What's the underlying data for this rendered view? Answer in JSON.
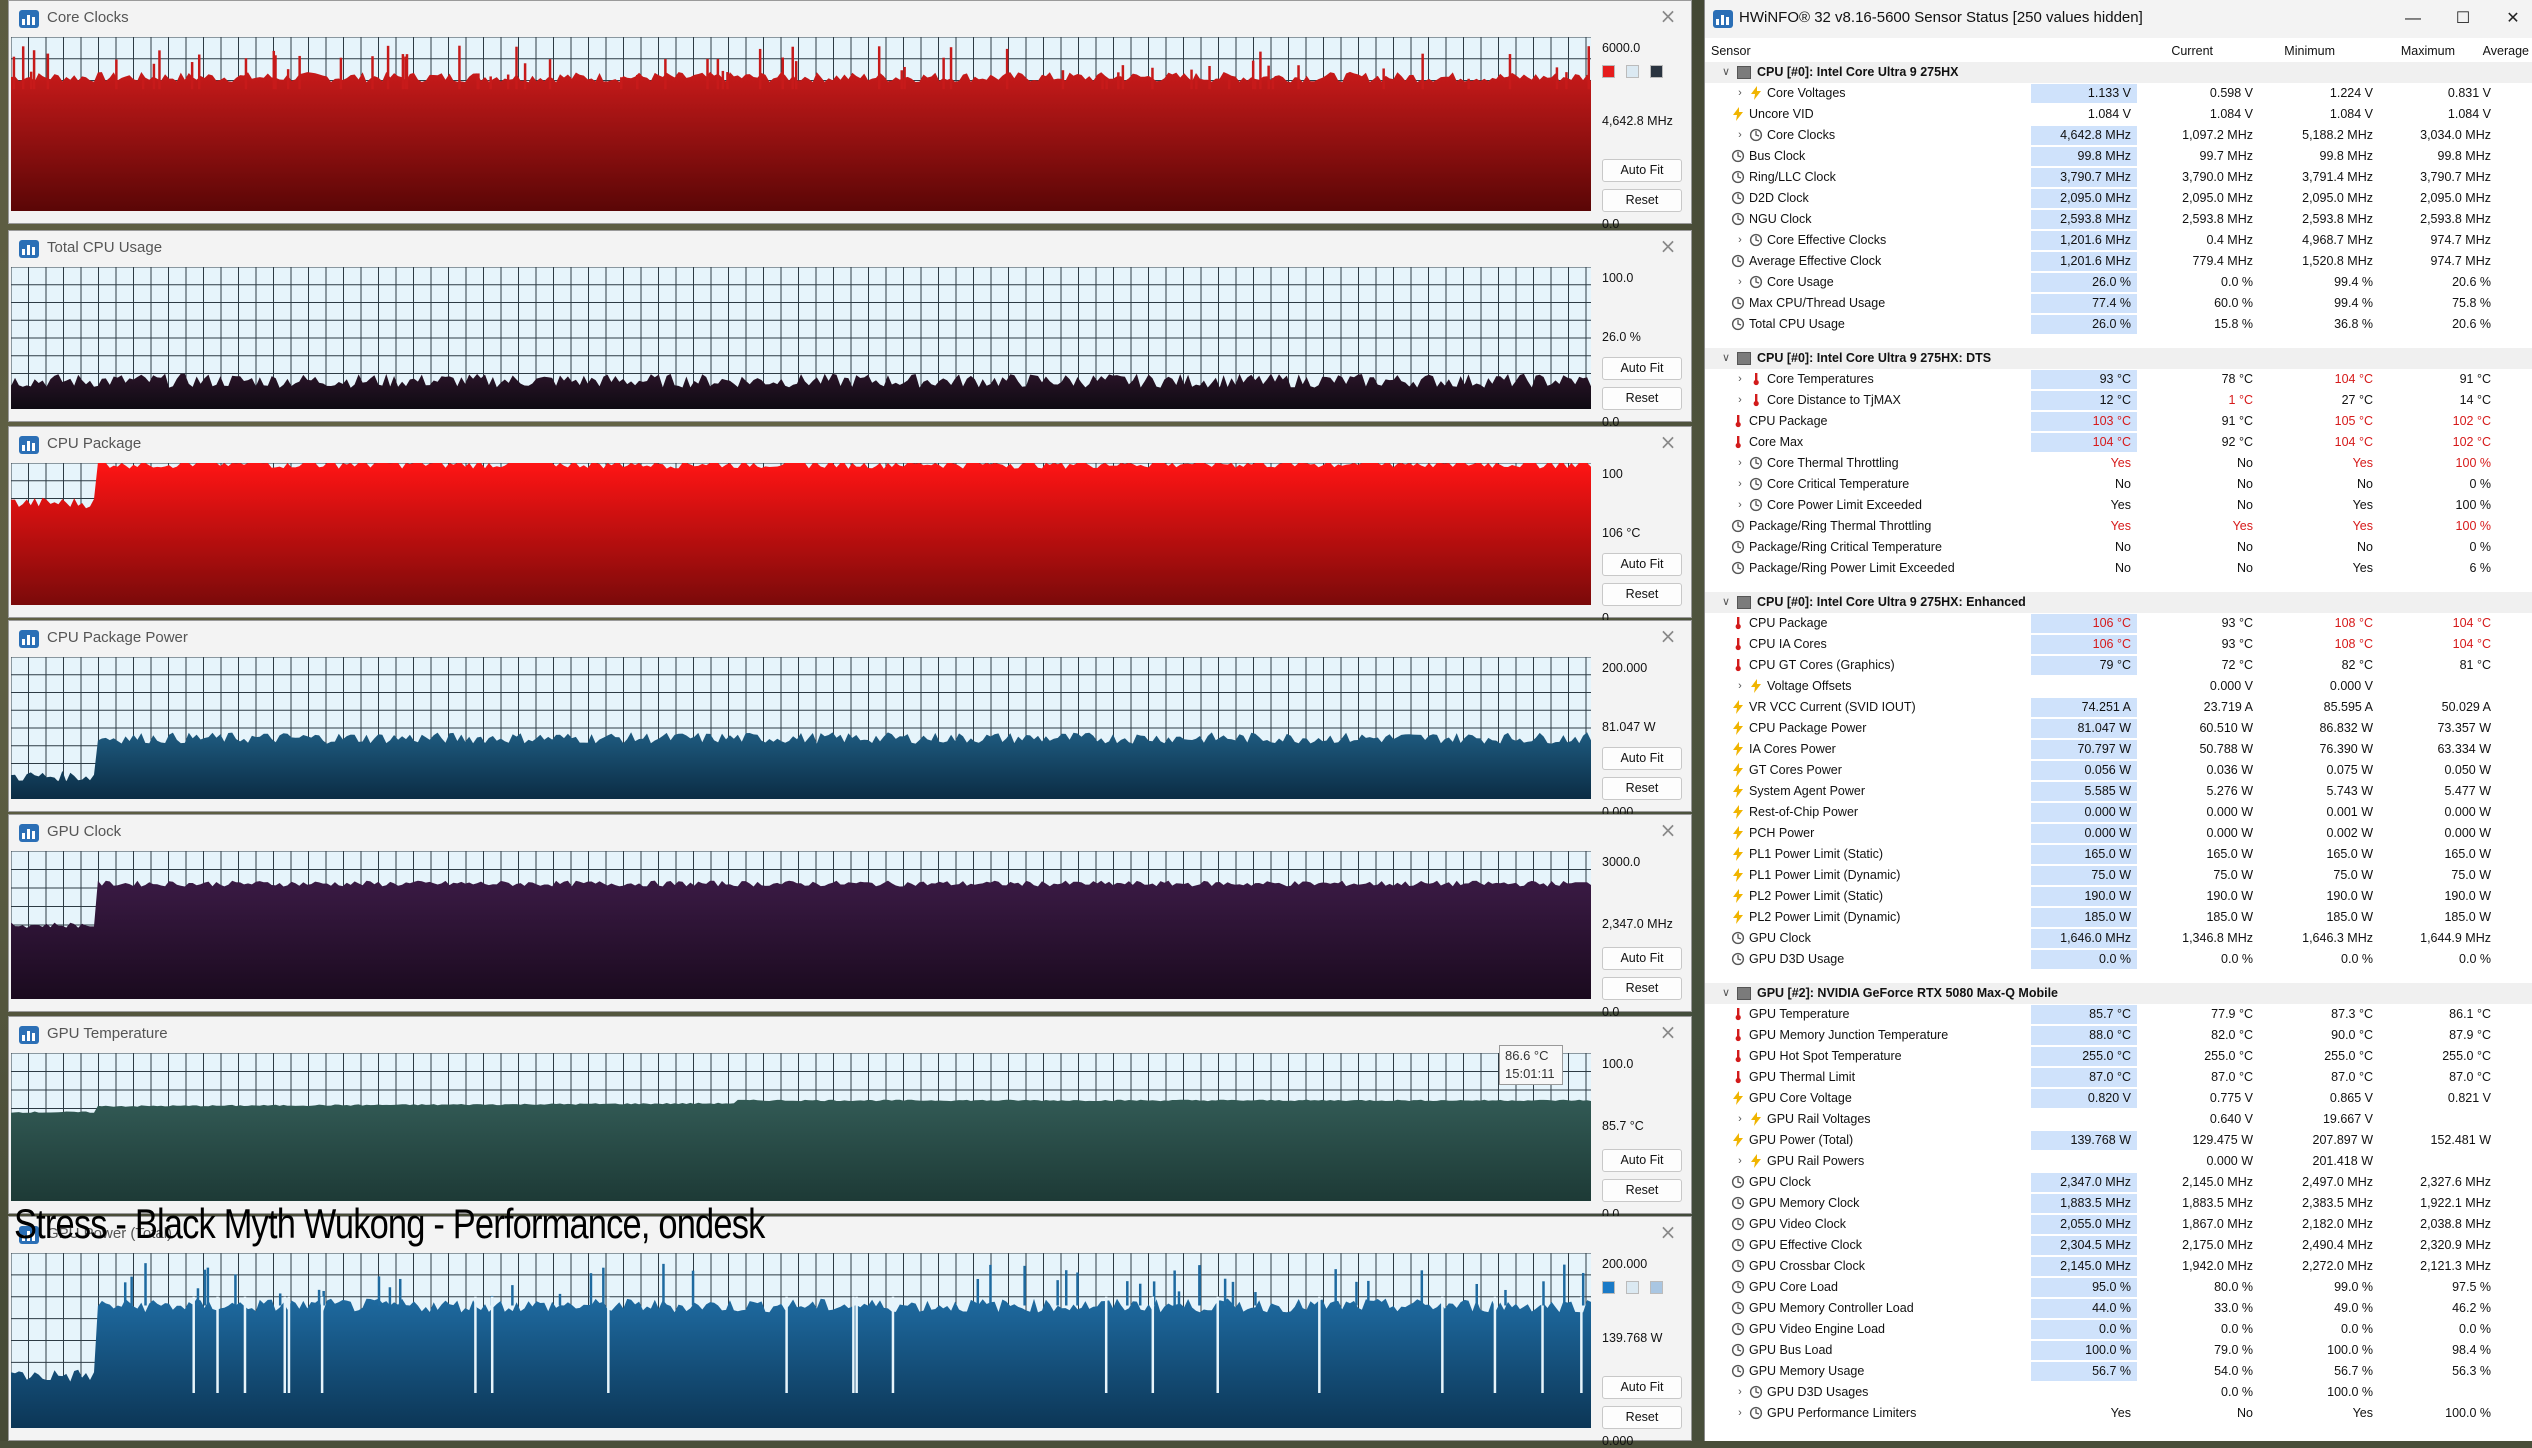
{
  "graphs": [
    {
      "title": "Core Clocks",
      "max": "6000.0",
      "current": "4,642.8 MHz",
      "min": "0.0",
      "autofit": "Auto Fit",
      "reset": "Reset",
      "swatches": [
        "#e51c1c",
        "#dbe9f2",
        "#2a3440"
      ],
      "series": {
        "color_top": "#c71a1a",
        "color_bottom": "#5a0606",
        "baseline_fraction": 0.77,
        "start_fraction": 0.77,
        "noise": 0.03,
        "spikes": true
      }
    },
    {
      "title": "Total CPU Usage",
      "max": "100.0",
      "current": "26.0 %",
      "min": "0.0",
      "autofit": "Auto Fit",
      "reset": "Reset",
      "swatches": [],
      "series": {
        "color_top": "#2a1428",
        "color_bottom": "#0e0a12",
        "baseline_fraction": 0.2,
        "start_fraction": 0.2,
        "noise": 0.05,
        "spikes": false
      }
    },
    {
      "title": "CPU Package",
      "max": "100",
      "current": "106 °C",
      "min": "0",
      "autofit": "Auto Fit",
      "reset": "Reset",
      "swatches": [],
      "series": {
        "color_top": "#ff1414",
        "color_bottom": "#7a0a0a",
        "baseline_fraction": 1.0,
        "start_fraction": 0.72,
        "noise": 0.04,
        "spikes": false
      }
    },
    {
      "title": "CPU Package Power",
      "max": "200.000",
      "current": "81.047 W",
      "min": "0.000",
      "autofit": "Auto Fit",
      "reset": "Reset",
      "swatches": [],
      "series": {
        "color_top": "#1e5b80",
        "color_bottom": "#0b2c44",
        "baseline_fraction": 0.43,
        "start_fraction": 0.16,
        "noise": 0.04,
        "spikes": false
      }
    },
    {
      "title": "GPU Clock",
      "max": "3000.0",
      "current": "2,347.0 MHz",
      "min": "0.0",
      "autofit": "Auto Fit",
      "reset": "Reset",
      "swatches": [],
      "series": {
        "color_top": "#3a1a44",
        "color_bottom": "#1a0a1e",
        "baseline_fraction": 0.78,
        "start_fraction": 0.5,
        "noise": 0.02,
        "spikes": false
      }
    },
    {
      "title": "GPU Temperature",
      "max": "100.0",
      "current": "85.7 °C",
      "min": "0.0",
      "autofit": "Auto Fit",
      "reset": "Reset",
      "swatches": [],
      "tooltip": {
        "line1": "86.6 °C",
        "line2": "15:01:11"
      },
      "series": {
        "color_top": "#325a55",
        "color_bottom": "#1d3a36",
        "baseline_fraction": 0.86,
        "start_fraction": 0.67,
        "noise": 0.005,
        "spikes": false
      }
    },
    {
      "title": "GPU Power (Total)",
      "max": "200.000",
      "current": "139.768 W",
      "min": "0.000",
      "autofit": "Auto Fit",
      "reset": "Reset",
      "swatches": [
        "#1a7ac6",
        "#dbe9f2",
        "#a9c6e2"
      ],
      "series": {
        "color_top": "#1e6aa0",
        "color_bottom": "#0c3656",
        "baseline_fraction": 0.7,
        "start_fraction": 0.3,
        "noise": 0.04,
        "spikes": true
      }
    }
  ],
  "overlay_caption": "Stress - Black Myth Wukong - Performance, ondesk",
  "hwinfo": {
    "title": "HWiNFO® 32 v8.16-5600 Sensor Status [250 values hidden]",
    "columns": {
      "sensor": "Sensor",
      "current": "Current",
      "minimum": "Minimum",
      "maximum": "Maximum",
      "average": "Average"
    },
    "rows": [
      {
        "type": "group",
        "label": "CPU [#0]: Intel Core Ultra 9 275HX"
      },
      {
        "label": "Core Voltages",
        "icon": "volt",
        "expand": true,
        "hl": true,
        "cur": "1.133 V",
        "min": "0.598 V",
        "max": "1.224 V",
        "avg": "0.831 V"
      },
      {
        "label": "Uncore VID",
        "icon": "volt",
        "hl": false,
        "cur": "1.084 V",
        "min": "1.084 V",
        "max": "1.084 V",
        "avg": "1.084 V"
      },
      {
        "label": "Core Clocks",
        "icon": "clock",
        "expand": true,
        "hl": true,
        "cur": "4,642.8 MHz",
        "min": "1,097.2 MHz",
        "max": "5,188.2 MHz",
        "avg": "3,034.0 MHz"
      },
      {
        "label": "Bus Clock",
        "icon": "clock",
        "hl": true,
        "cur": "99.8 MHz",
        "min": "99.7 MHz",
        "max": "99.8 MHz",
        "avg": "99.8 MHz"
      },
      {
        "label": "Ring/LLC Clock",
        "icon": "clock",
        "hl": true,
        "cur": "3,790.7 MHz",
        "min": "3,790.0 MHz",
        "max": "3,791.4 MHz",
        "avg": "3,790.7 MHz"
      },
      {
        "label": "D2D Clock",
        "icon": "clock",
        "hl": true,
        "cur": "2,095.0 MHz",
        "min": "2,095.0 MHz",
        "max": "2,095.0 MHz",
        "avg": "2,095.0 MHz"
      },
      {
        "label": "NGU Clock",
        "icon": "clock",
        "hl": true,
        "cur": "2,593.8 MHz",
        "min": "2,593.8 MHz",
        "max": "2,593.8 MHz",
        "avg": "2,593.8 MHz"
      },
      {
        "label": "Core Effective Clocks",
        "icon": "clock",
        "expand": true,
        "hl": true,
        "cur": "1,201.6 MHz",
        "min": "0.4 MHz",
        "max": "4,968.7 MHz",
        "avg": "974.7 MHz"
      },
      {
        "label": "Average Effective Clock",
        "icon": "clock",
        "hl": true,
        "cur": "1,201.6 MHz",
        "min": "779.4 MHz",
        "max": "1,520.8 MHz",
        "avg": "974.7 MHz"
      },
      {
        "label": "Core Usage",
        "icon": "clock",
        "expand": true,
        "hl": true,
        "cur": "26.0 %",
        "min": "0.0 %",
        "max": "99.4 %",
        "avg": "20.6 %"
      },
      {
        "label": "Max CPU/Thread Usage",
        "icon": "clock",
        "hl": true,
        "cur": "77.4 %",
        "min": "60.0 %",
        "max": "99.4 %",
        "avg": "75.8 %"
      },
      {
        "label": "Total CPU Usage",
        "icon": "clock",
        "hl": true,
        "cur": "26.0 %",
        "min": "15.8 %",
        "max": "36.8 %",
        "avg": "20.6 %"
      },
      {
        "type": "spacer"
      },
      {
        "type": "group",
        "label": "CPU [#0]: Intel Core Ultra 9 275HX: DTS"
      },
      {
        "label": "Core Temperatures",
        "icon": "temp",
        "expand": true,
        "hl": true,
        "cur": "93 °C",
        "min": "78 °C",
        "max": "104 °C",
        "avg": "91 °C",
        "maxRed": true
      },
      {
        "label": "Core Distance to TjMAX",
        "icon": "temp",
        "expand": true,
        "hl": true,
        "cur": "12 °C",
        "min": "1 °C",
        "max": "27 °C",
        "avg": "14 °C",
        "minRed": true
      },
      {
        "label": "CPU Package",
        "icon": "temp",
        "hl": true,
        "cur": "103 °C",
        "min": "91 °C",
        "max": "105 °C",
        "avg": "102 °C",
        "curRed": true,
        "maxRed": true,
        "avgRed": true
      },
      {
        "label": "Core Max",
        "icon": "temp",
        "hl": true,
        "cur": "104 °C",
        "min": "92 °C",
        "max": "104 °C",
        "avg": "102 °C",
        "curRed": true,
        "maxRed": true,
        "avgRed": true
      },
      {
        "label": "Core Thermal Throttling",
        "icon": "clock",
        "expand": true,
        "hl": false,
        "cur": "Yes",
        "min": "No",
        "max": "Yes",
        "avg": "100 %",
        "curRed": true,
        "maxRed": true,
        "avgRed": true
      },
      {
        "label": "Core Critical Temperature",
        "icon": "clock",
        "expand": true,
        "hl": false,
        "cur": "No",
        "min": "No",
        "max": "No",
        "avg": "0 %"
      },
      {
        "label": "Core Power Limit Exceeded",
        "icon": "clock",
        "expand": true,
        "hl": false,
        "cur": "Yes",
        "min": "No",
        "max": "Yes",
        "avg": "100 %"
      },
      {
        "label": "Package/Ring Thermal Throttling",
        "icon": "clock",
        "hl": false,
        "cur": "Yes",
        "min": "Yes",
        "max": "Yes",
        "avg": "100 %",
        "curRed": true,
        "minRed": true,
        "maxRed": true,
        "avgRed": true
      },
      {
        "label": "Package/Ring Critical Temperature",
        "icon": "clock",
        "hl": false,
        "cur": "No",
        "min": "No",
        "max": "No",
        "avg": "0 %"
      },
      {
        "label": "Package/Ring Power Limit Exceeded",
        "icon": "clock",
        "hl": false,
        "cur": "No",
        "min": "No",
        "max": "Yes",
        "avg": "6 %"
      },
      {
        "type": "spacer"
      },
      {
        "type": "group",
        "label": "CPU [#0]: Intel Core Ultra 9 275HX: Enhanced"
      },
      {
        "label": "CPU Package",
        "icon": "temp",
        "hl": true,
        "cur": "106 °C",
        "min": "93 °C",
        "max": "108 °C",
        "avg": "104 °C",
        "curRed": true,
        "maxRed": true,
        "avgRed": true
      },
      {
        "label": "CPU IA Cores",
        "icon": "temp",
        "hl": true,
        "cur": "106 °C",
        "min": "93 °C",
        "max": "108 °C",
        "avg": "104 °C",
        "curRed": true,
        "maxRed": true,
        "avgRed": true
      },
      {
        "label": "CPU GT Cores (Graphics)",
        "icon": "temp",
        "hl": true,
        "cur": "79 °C",
        "min": "72 °C",
        "max": "82 °C",
        "avg": "81 °C"
      },
      {
        "label": "Voltage Offsets",
        "icon": "volt",
        "expand": true,
        "hl": false,
        "cur": "",
        "min": "0.000 V",
        "max": "0.000 V",
        "avg": ""
      },
      {
        "label": "VR VCC Current (SVID IOUT)",
        "icon": "volt",
        "hl": true,
        "cur": "74.251 A",
        "min": "23.719 A",
        "max": "85.595 A",
        "avg": "50.029 A"
      },
      {
        "label": "CPU Package Power",
        "icon": "volt",
        "hl": true,
        "cur": "81.047 W",
        "min": "60.510 W",
        "max": "86.832 W",
        "avg": "73.357 W"
      },
      {
        "label": "IA Cores Power",
        "icon": "volt",
        "hl": true,
        "cur": "70.797 W",
        "min": "50.788 W",
        "max": "76.390 W",
        "avg": "63.334 W"
      },
      {
        "label": "GT Cores Power",
        "icon": "volt",
        "hl": true,
        "cur": "0.056 W",
        "min": "0.036 W",
        "max": "0.075 W",
        "avg": "0.050 W"
      },
      {
        "label": "System Agent Power",
        "icon": "volt",
        "hl": true,
        "cur": "5.585 W",
        "min": "5.276 W",
        "max": "5.743 W",
        "avg": "5.477 W"
      },
      {
        "label": "Rest-of-Chip Power",
        "icon": "volt",
        "hl": true,
        "cur": "0.000 W",
        "min": "0.000 W",
        "max": "0.001 W",
        "avg": "0.000 W"
      },
      {
        "label": "PCH Power",
        "icon": "volt",
        "hl": true,
        "cur": "0.000 W",
        "min": "0.000 W",
        "max": "0.002 W",
        "avg": "0.000 W"
      },
      {
        "label": "PL1 Power Limit (Static)",
        "icon": "volt",
        "hl": true,
        "cur": "165.0 W",
        "min": "165.0 W",
        "max": "165.0 W",
        "avg": "165.0 W"
      },
      {
        "label": "PL1 Power Limit (Dynamic)",
        "icon": "volt",
        "hl": true,
        "cur": "75.0 W",
        "min": "75.0 W",
        "max": "75.0 W",
        "avg": "75.0 W"
      },
      {
        "label": "PL2 Power Limit (Static)",
        "icon": "volt",
        "hl": true,
        "cur": "190.0 W",
        "min": "190.0 W",
        "max": "190.0 W",
        "avg": "190.0 W"
      },
      {
        "label": "PL2 Power Limit (Dynamic)",
        "icon": "volt",
        "hl": true,
        "cur": "185.0 W",
        "min": "185.0 W",
        "max": "185.0 W",
        "avg": "185.0 W"
      },
      {
        "label": "GPU Clock",
        "icon": "clock",
        "hl": true,
        "cur": "1,646.0 MHz",
        "min": "1,346.8 MHz",
        "max": "1,646.3 MHz",
        "avg": "1,644.9 MHz"
      },
      {
        "label": "GPU D3D Usage",
        "icon": "clock",
        "hl": true,
        "cur": "0.0 %",
        "min": "0.0 %",
        "max": "0.0 %",
        "avg": "0.0 %"
      },
      {
        "type": "spacer"
      },
      {
        "type": "group",
        "label": "GPU [#2]: NVIDIA  GeForce RTX 5080 Max-Q Mobile"
      },
      {
        "label": "GPU Temperature",
        "icon": "temp",
        "hl": true,
        "cur": "85.7 °C",
        "min": "77.9 °C",
        "max": "87.3 °C",
        "avg": "86.1 °C"
      },
      {
        "label": "GPU Memory Junction Temperature",
        "icon": "temp",
        "hl": true,
        "cur": "88.0 °C",
        "min": "82.0 °C",
        "max": "90.0 °C",
        "avg": "87.9 °C"
      },
      {
        "label": "GPU Hot Spot Temperature",
        "icon": "temp",
        "hl": true,
        "cur": "255.0 °C",
        "min": "255.0 °C",
        "max": "255.0 °C",
        "avg": "255.0 °C"
      },
      {
        "label": "GPU Thermal Limit",
        "icon": "temp",
        "hl": true,
        "cur": "87.0 °C",
        "min": "87.0 °C",
        "max": "87.0 °C",
        "avg": "87.0 °C"
      },
      {
        "label": "GPU Core Voltage",
        "icon": "volt",
        "hl": true,
        "cur": "0.820 V",
        "min": "0.775 V",
        "max": "0.865 V",
        "avg": "0.821 V"
      },
      {
        "label": "GPU Rail Voltages",
        "icon": "volt",
        "expand": true,
        "hl": false,
        "cur": "",
        "min": "0.640 V",
        "max": "19.667 V",
        "avg": ""
      },
      {
        "label": "GPU Power (Total)",
        "icon": "volt",
        "hl": true,
        "cur": "139.768 W",
        "min": "129.475 W",
        "max": "207.897 W",
        "avg": "152.481 W"
      },
      {
        "label": "GPU Rail Powers",
        "icon": "volt",
        "expand": true,
        "hl": false,
        "cur": "",
        "min": "0.000 W",
        "max": "201.418 W",
        "avg": ""
      },
      {
        "label": "GPU Clock",
        "icon": "clock",
        "hl": true,
        "cur": "2,347.0 MHz",
        "min": "2,145.0 MHz",
        "max": "2,497.0 MHz",
        "avg": "2,327.6 MHz"
      },
      {
        "label": "GPU Memory Clock",
        "icon": "clock",
        "hl": true,
        "cur": "1,883.5 MHz",
        "min": "1,883.5 MHz",
        "max": "2,383.5 MHz",
        "avg": "1,922.1 MHz"
      },
      {
        "label": "GPU Video Clock",
        "icon": "clock",
        "hl": true,
        "cur": "2,055.0 MHz",
        "min": "1,867.0 MHz",
        "max": "2,182.0 MHz",
        "avg": "2,038.8 MHz"
      },
      {
        "label": "GPU Effective Clock",
        "icon": "clock",
        "hl": true,
        "cur": "2,304.5 MHz",
        "min": "2,175.0 MHz",
        "max": "2,490.4 MHz",
        "avg": "2,320.9 MHz"
      },
      {
        "label": "GPU Crossbar Clock",
        "icon": "clock",
        "hl": true,
        "cur": "2,145.0 MHz",
        "min": "1,942.0 MHz",
        "max": "2,272.0 MHz",
        "avg": "2,121.3 MHz"
      },
      {
        "label": "GPU Core Load",
        "icon": "clock",
        "hl": true,
        "cur": "95.0 %",
        "min": "80.0 %",
        "max": "99.0 %",
        "avg": "97.5 %"
      },
      {
        "label": "GPU Memory Controller Load",
        "icon": "clock",
        "hl": true,
        "cur": "44.0 %",
        "min": "33.0 %",
        "max": "49.0 %",
        "avg": "46.2 %"
      },
      {
        "label": "GPU Video Engine Load",
        "icon": "clock",
        "hl": true,
        "cur": "0.0 %",
        "min": "0.0 %",
        "max": "0.0 %",
        "avg": "0.0 %"
      },
      {
        "label": "GPU Bus Load",
        "icon": "clock",
        "hl": true,
        "cur": "100.0 %",
        "min": "79.0 %",
        "max": "100.0 %",
        "avg": "98.4 %"
      },
      {
        "label": "GPU Memory Usage",
        "icon": "clock",
        "hl": true,
        "cur": "56.7 %",
        "min": "54.0 %",
        "max": "56.7 %",
        "avg": "56.3 %"
      },
      {
        "label": "GPU D3D Usages",
        "icon": "clock",
        "expand": true,
        "hl": false,
        "cur": "",
        "min": "0.0 %",
        "max": "100.0 %",
        "avg": ""
      },
      {
        "label": "GPU Performance Limiters",
        "icon": "clock",
        "expand": true,
        "hl": false,
        "cur": "Yes",
        "min": "No",
        "max": "Yes",
        "avg": "100.0 %"
      }
    ]
  }
}
